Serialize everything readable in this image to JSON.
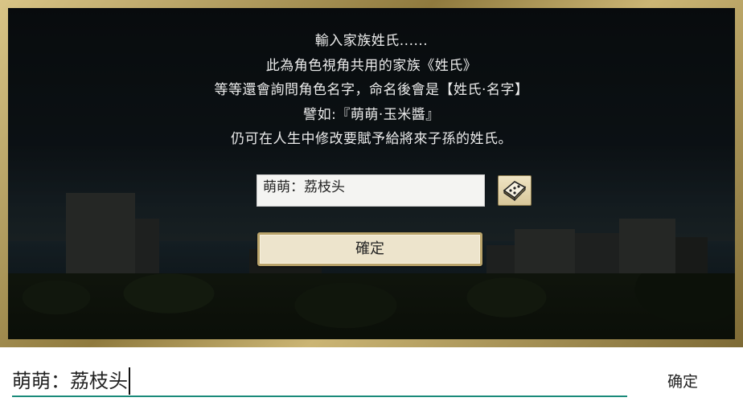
{
  "dialog": {
    "lines": [
      "輸入家族姓氏......",
      "此為角色視角共用的家族《姓氏》",
      "等等還會詢問角色名字，命名後會是【姓氏‧名字】",
      "譬如:『萌萌‧玉米醬』",
      "仍可在人生中修改要賦予給將來子孫的姓氏。"
    ],
    "name_value": "萌萌：荔枝头",
    "dice_icon": "dice-icon",
    "confirm_label": "確定"
  },
  "ime": {
    "input_value": "萌萌：荔枝头",
    "done_label": "确定",
    "accent_color": "#1a8a7a"
  }
}
